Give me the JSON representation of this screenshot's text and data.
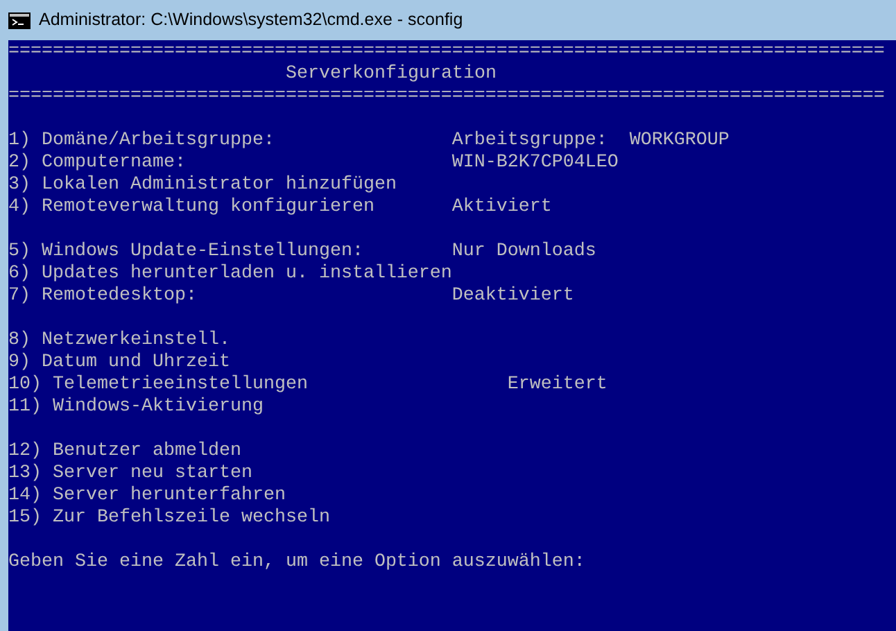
{
  "window": {
    "title": "Administrator: C:\\Windows\\system32\\cmd.exe - sconfig"
  },
  "console": {
    "separator_top": "===============================================================================",
    "heading": "Serverkonfiguration",
    "separator_bottom": "===============================================================================",
    "groups": [
      [
        "1) Domäne/Arbeitsgruppe:                Arbeitsgruppe:  WORKGROUP",
        "2) Computername:                        WIN-B2K7CP04LEO",
        "3) Lokalen Administrator hinzufügen",
        "4) Remoteverwaltung konfigurieren       Aktiviert"
      ],
      [
        "5) Windows Update-Einstellungen:        Nur Downloads",
        "6) Updates herunterladen u. installieren",
        "7) Remotedesktop:                       Deaktiviert"
      ],
      [
        "8) Netzwerkeinstell.",
        "9) Datum und Uhrzeit",
        "10) Telemetrieeinstellungen                  Erweitert",
        "11) Windows-Aktivierung"
      ],
      [
        "12) Benutzer abmelden",
        "13) Server neu starten",
        "14) Server herunterfahren",
        "15) Zur Befehlszeile wechseln"
      ]
    ],
    "prompt": "Geben Sie eine Zahl ein, um eine Option auszuwählen:"
  }
}
